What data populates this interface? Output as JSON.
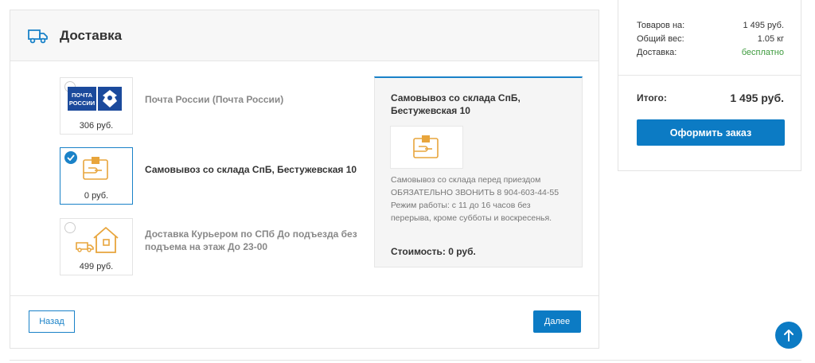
{
  "delivery": {
    "title": "Доставка",
    "options": [
      {
        "name": "Почта России (Почта России)",
        "price": "306 руб.",
        "selected": false,
        "logo_text_1": "ПОЧТА",
        "logo_text_2": "РОССИИ"
      },
      {
        "name": "Самовывоз со склада СпБ, Бестужевская 10",
        "price": "0 руб.",
        "selected": true
      },
      {
        "name": "Доставка Курьером по СПб До подъезда без подъема на этаж До 23-00",
        "price": "499 руб.",
        "selected": false
      }
    ],
    "detail": {
      "title": "Самовывоз со склада СпБ, Бестужевская 10",
      "description": "Самовывоз со склада перед приездом ОБЯЗАТЕЛЬНО ЗВОНИТЬ 8 904-603-44-55 Режим работы: с 11 до 16 часов без перерыва, кроме субботы и воскресенья.",
      "cost_label": "Стоимость:",
      "cost_value": "0 руб."
    },
    "back_label": "Назад",
    "next_label": "Далее"
  },
  "summary": {
    "goods_label": "Товаров на:",
    "goods_value": "1 495 руб.",
    "weight_label": "Общий вес:",
    "weight_value": "1.05 кг",
    "delivery_label": "Доставка:",
    "delivery_value": "бесплатно",
    "total_label": "Итого:",
    "total_value": "1 495 руб.",
    "order_button": "Оформить заказ"
  },
  "colors": {
    "accent": "#0c7bc4",
    "free_green": "#3e9b3e",
    "icon_orange": "#e8a53c"
  },
  "icons": [
    "truck-icon",
    "checkmark-icon",
    "pochta-logo",
    "pickup-hand-icon",
    "courier-house-icon",
    "arrow-up-icon"
  ]
}
